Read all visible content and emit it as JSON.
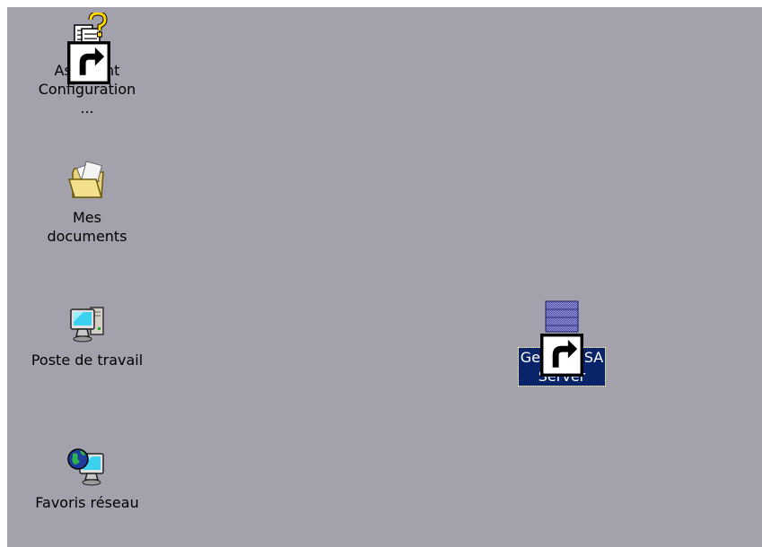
{
  "desktop": {
    "background": "#a3a1ab",
    "icons": [
      {
        "id": "assistant",
        "label_line1": "Assistant",
        "label_line2": "Configuration ...",
        "icon": "help-document-icon",
        "shortcut": true
      },
      {
        "id": "mydocs",
        "label_line1": "Mes documents",
        "icon": "folder-documents-icon",
        "shortcut": false
      },
      {
        "id": "mypc",
        "label_line1": "Poste de travail",
        "icon": "computer-icon",
        "shortcut": false
      },
      {
        "id": "network",
        "label_line1": "Favoris réseau",
        "icon": "network-globe-icon",
        "shortcut": false
      },
      {
        "id": "isa",
        "label_line1": "Gestion ISA",
        "label_line2": "Server",
        "icon": "server-icon",
        "shortcut": true,
        "selected": true
      }
    ]
  },
  "colors": {
    "selection": "#0a246a",
    "selection_text": "#ffffff"
  }
}
